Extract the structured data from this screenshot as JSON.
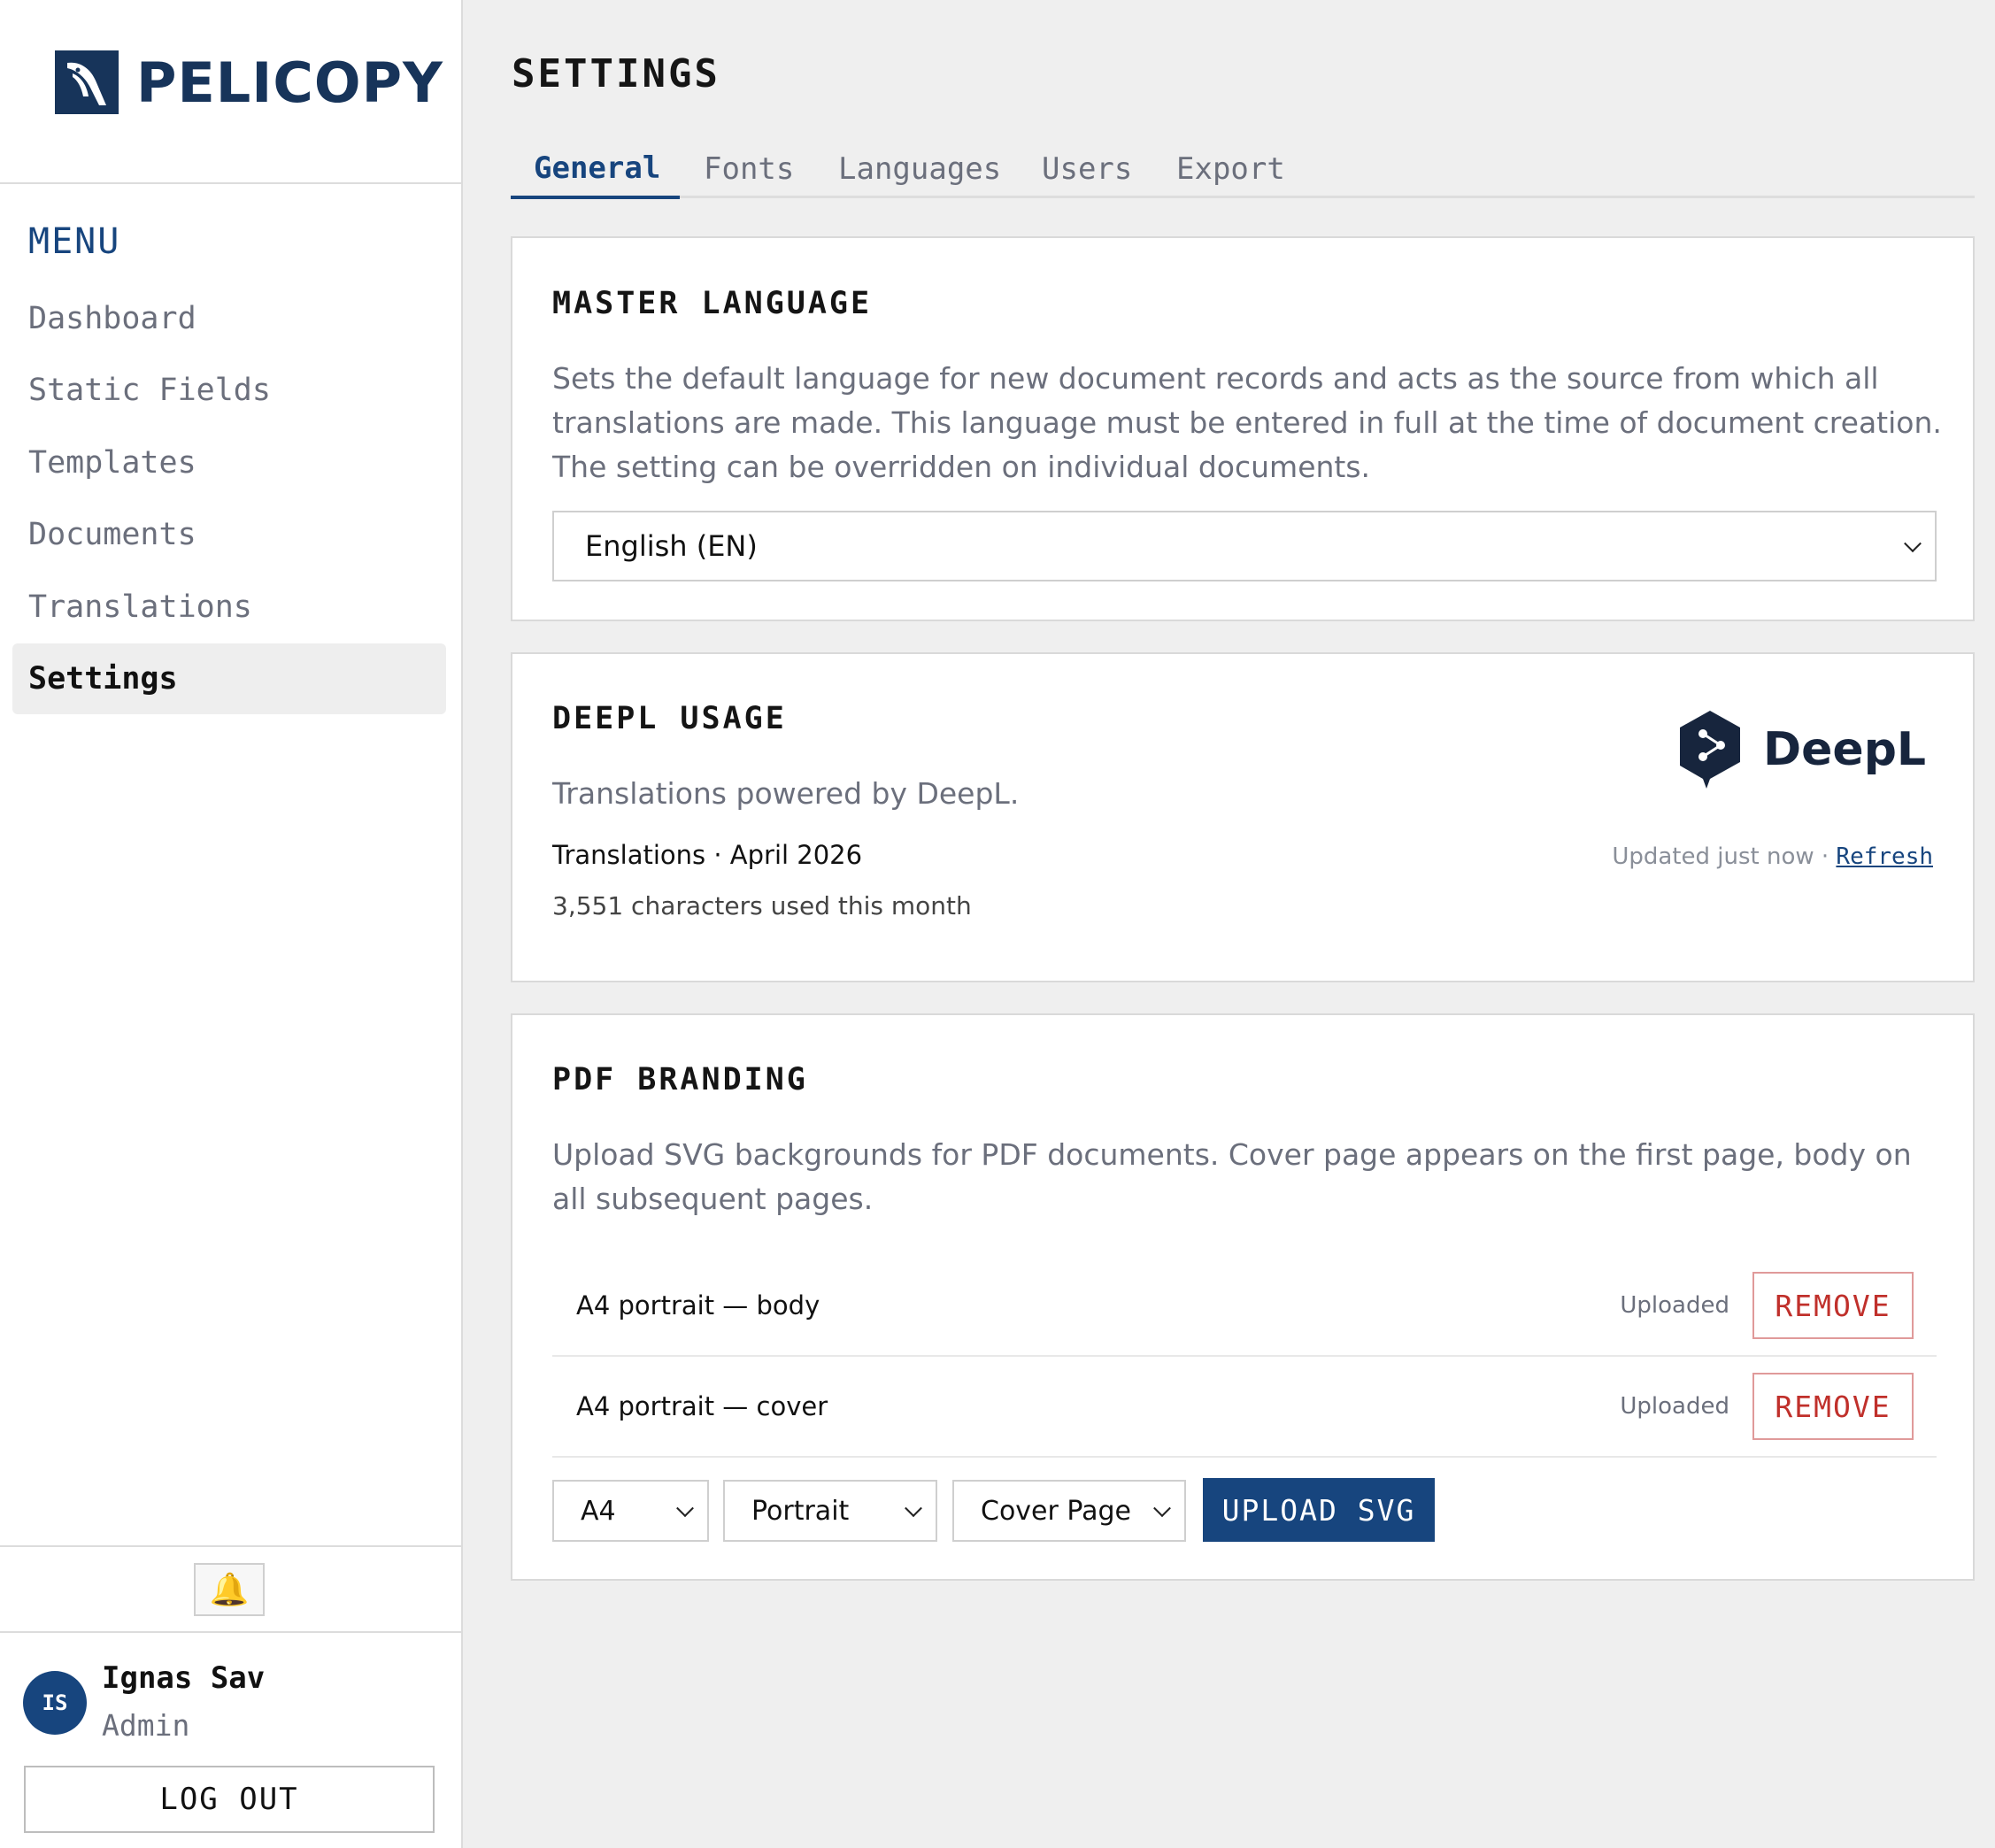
{
  "sidebar": {
    "brand": {
      "name": "PELICOPY",
      "icon": "pelican-logo-icon"
    },
    "menu_heading": "MENU",
    "items": [
      {
        "label": "Dashboard",
        "active": false
      },
      {
        "label": "Static Fields",
        "active": false
      },
      {
        "label": "Templates",
        "active": false
      },
      {
        "label": "Documents",
        "active": false
      },
      {
        "label": "Translations",
        "active": false
      },
      {
        "label": "Settings",
        "active": true
      }
    ],
    "notifications_icon": "bell-icon",
    "user": {
      "initials": "IS",
      "name": "Ignas Sav",
      "role": "Admin"
    },
    "logout_label": "LOG OUT"
  },
  "page": {
    "title": "SETTINGS",
    "tabs": [
      {
        "label": "General",
        "active": true
      },
      {
        "label": "Fonts",
        "active": false
      },
      {
        "label": "Languages",
        "active": false
      },
      {
        "label": "Users",
        "active": false
      },
      {
        "label": "Export",
        "active": false
      }
    ]
  },
  "master_language": {
    "title": "MASTER LANGUAGE",
    "description": "Sets the default language for new document records and acts as the source from which all translations are made. This language must be entered in full at the time of document creation. The setting can be overridden on individual documents.",
    "selected": "English (EN)"
  },
  "deepl": {
    "title": "DEEPL USAGE",
    "logo_text": "DeepL",
    "description": "Translations powered by DeepL.",
    "period": "Translations · April 2026",
    "usage": "3,551 characters used this month",
    "updated": "Updated just now · ",
    "refresh_label": "Refresh"
  },
  "pdf_branding": {
    "title": "PDF BRANDING",
    "description": "Upload SVG backgrounds for PDF documents. Cover page appears on the first page, body on all subsequent pages.",
    "rows": [
      {
        "label": "A4 portrait — body",
        "status": "Uploaded",
        "action": "REMOVE"
      },
      {
        "label": "A4 portrait — cover",
        "status": "Uploaded",
        "action": "REMOVE"
      }
    ],
    "size_select": "A4",
    "orientation_select": "Portrait",
    "page_select": "Cover Page",
    "upload_label": "UPLOAD SVG"
  },
  "colors": {
    "brand": "#17345a",
    "accent": "#17457e",
    "danger": "#c0302b"
  }
}
